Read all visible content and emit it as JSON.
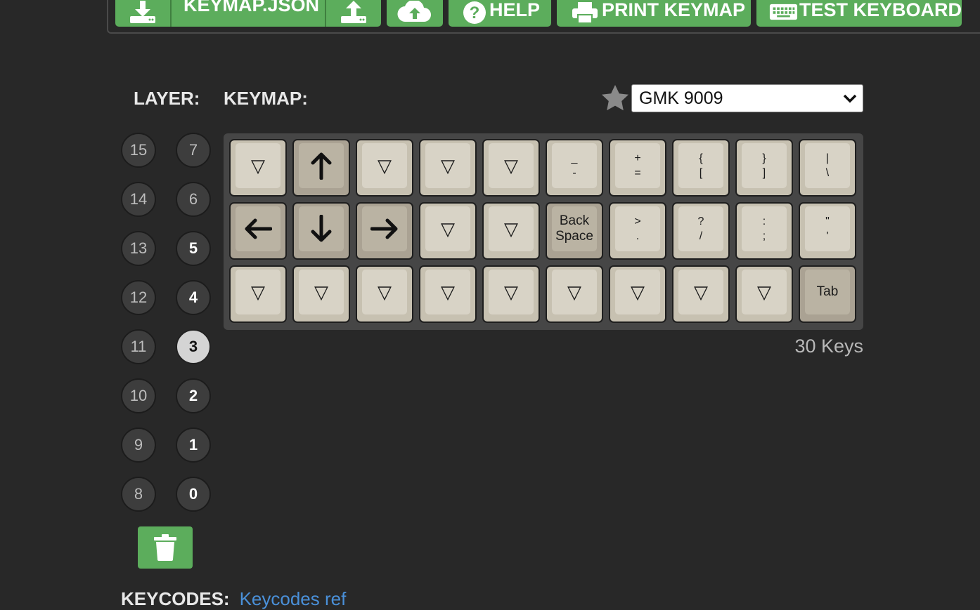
{
  "toolbar": {
    "keymap_json_label": "KEYMAP.JSON",
    "help_label": "HELP",
    "print_label": "PRINT KEYMAP",
    "test_label": "TEST KEYBOARD",
    "download_icon": "download-icon",
    "upload_icon": "upload-icon",
    "cloud_icon": "cloud-upload-icon",
    "help_icon": "question-circle-icon",
    "print_icon": "printer-icon",
    "keyboard_icon": "keyboard-icon"
  },
  "labels": {
    "layer": "LAYER:",
    "keymap": "KEYMAP:"
  },
  "keyset": {
    "selected": "GMK 9009",
    "favorite_icon": "star-icon"
  },
  "layers": {
    "left": [
      "15",
      "14",
      "13",
      "12",
      "11",
      "10",
      "9",
      "8"
    ],
    "right": [
      "7",
      "6",
      "5",
      "4",
      "3",
      "2",
      "1",
      "0"
    ],
    "used": [
      "5",
      "4",
      "3",
      "2",
      "1",
      "0"
    ],
    "active": "3"
  },
  "keys": [
    {
      "top": "▽",
      "bottom": ""
    },
    {
      "top": "↑",
      "bottom": ""
    },
    {
      "top": "▽",
      "bottom": ""
    },
    {
      "top": "▽",
      "bottom": ""
    },
    {
      "top": "▽",
      "bottom": ""
    },
    {
      "top": "_",
      "bottom": "-"
    },
    {
      "top": "+",
      "bottom": "="
    },
    {
      "top": "{",
      "bottom": "["
    },
    {
      "top": "}",
      "bottom": "]"
    },
    {
      "top": "|",
      "bottom": "\\"
    },
    {
      "top": "←",
      "bottom": ""
    },
    {
      "top": "↓",
      "bottom": ""
    },
    {
      "top": "→",
      "bottom": ""
    },
    {
      "top": "▽",
      "bottom": ""
    },
    {
      "top": "▽",
      "bottom": ""
    },
    {
      "top": "Back",
      "bottom": "Space"
    },
    {
      "top": ">",
      "bottom": "."
    },
    {
      "top": "?",
      "bottom": "/"
    },
    {
      "top": ":",
      "bottom": ";"
    },
    {
      "top": "\"",
      "bottom": "'"
    },
    {
      "top": "▽",
      "bottom": ""
    },
    {
      "top": "▽",
      "bottom": ""
    },
    {
      "top": "▽",
      "bottom": ""
    },
    {
      "top": "▽",
      "bottom": ""
    },
    {
      "top": "▽",
      "bottom": ""
    },
    {
      "top": "▽",
      "bottom": ""
    },
    {
      "top": "▽",
      "bottom": ""
    },
    {
      "top": "▽",
      "bottom": ""
    },
    {
      "top": "▽",
      "bottom": ""
    },
    {
      "top": "Tab",
      "bottom": ""
    }
  ],
  "key_count": "30 Keys",
  "trash_icon": "trash-icon",
  "keycodes": {
    "label": "KEYCODES:",
    "link": "Keycodes ref"
  }
}
